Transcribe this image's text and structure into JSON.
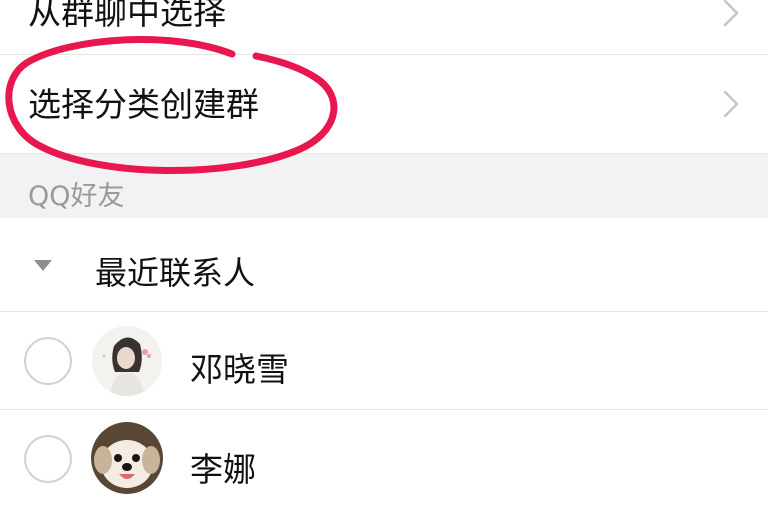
{
  "menu": {
    "from_group_chat": "从群聊中选择",
    "by_category": "选择分类创建群"
  },
  "section": {
    "qq_friends": "QQ好友"
  },
  "group": {
    "recent_contacts": "最近联系人"
  },
  "contacts": [
    {
      "name": "邓晓雪"
    },
    {
      "name": "李娜"
    }
  ],
  "colors": {
    "annotation": "#e8174e",
    "separator": "#e5e5e5",
    "section_bg": "#f2f2f4",
    "secondary_text": "#9a9a9a"
  }
}
